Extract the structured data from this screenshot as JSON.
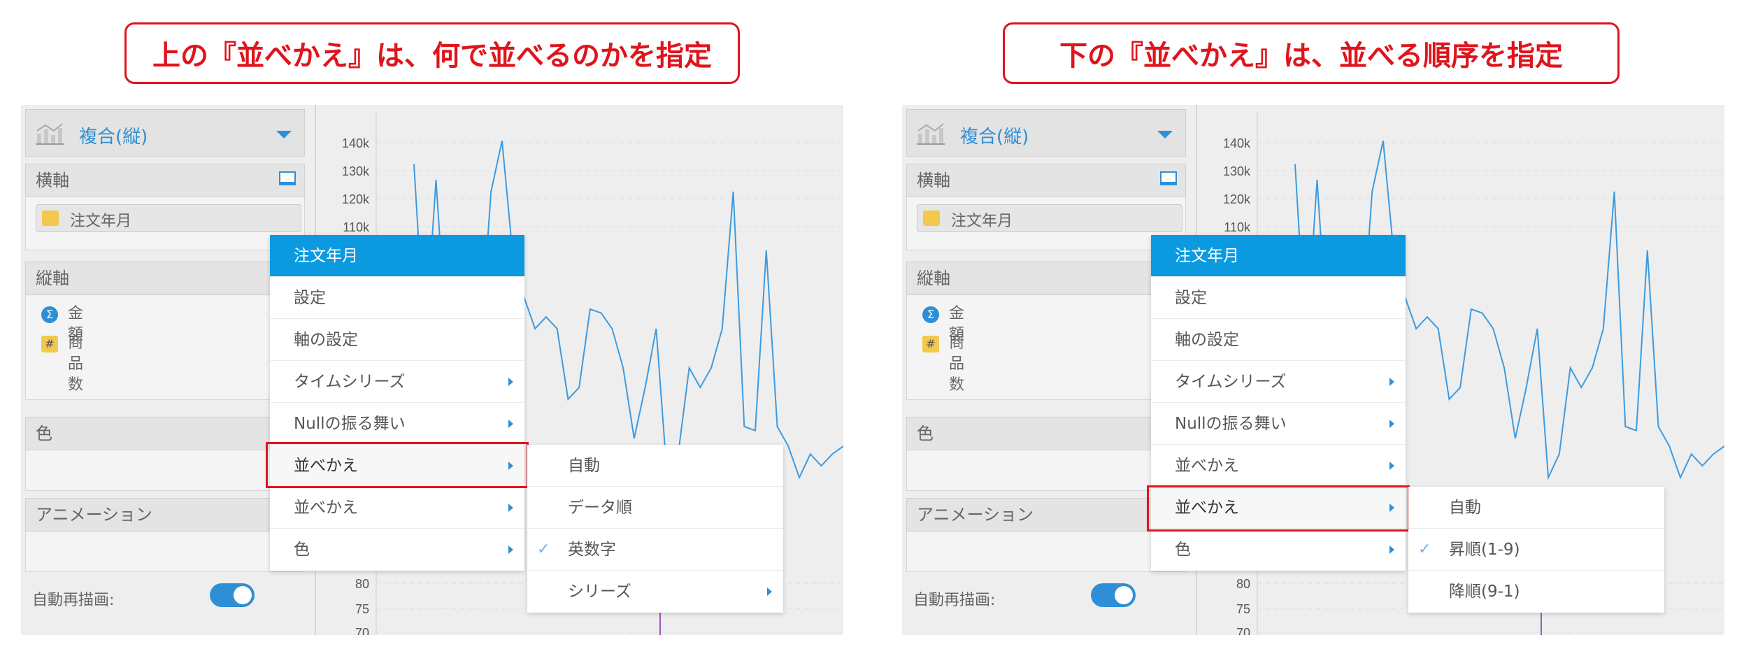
{
  "callouts": {
    "left": "上の『並べかえ』は、何で並べるのかを指定",
    "right": "下の『並べかえ』は、並べる順序を指定"
  },
  "sidebar": {
    "chart_type": "複合(縦)",
    "x_axis_title": "横軸",
    "x_field": "注文年月",
    "y_axis_title": "縦軸",
    "measures": [
      {
        "icon": "Σ",
        "label": "金額"
      },
      {
        "icon": "#",
        "label": "商品数"
      }
    ],
    "color_title": "色",
    "animation_title": "アニメーション",
    "auto_redraw_label": "自動再描画:"
  },
  "chart": {
    "y_ticks_top": [
      "140k",
      "130k",
      "120k",
      "110k"
    ],
    "y_ticks_bottom": [
      "80",
      "75",
      "70"
    ],
    "line_color": "#3d9be0",
    "purple": "#9b59b6",
    "series_points": [
      0.08,
      0.55,
      0.12,
      0.55,
      0.55,
      0.55,
      0.55,
      0.15,
      0.02,
      0.32,
      0.42,
      0.5,
      0.47,
      0.5,
      0.68,
      0.65,
      0.45,
      0.46,
      0.5,
      0.6,
      0.78,
      0.65,
      0.5,
      0.88,
      0.82,
      0.6,
      0.65,
      0.6,
      0.5,
      0.15,
      0.75,
      0.76,
      0.3,
      0.75,
      0.8,
      0.88,
      0.82,
      0.85,
      0.82,
      0.8
    ]
  },
  "left_menu": {
    "header": "注文年月",
    "items": [
      "設定",
      "軸の設定",
      "タイムシリーズ",
      "Nullの振る舞い",
      "並べかえ",
      "並べかえ",
      "色"
    ],
    "submenu": [
      "自動",
      "データ順",
      "英数字",
      "シリーズ"
    ],
    "checked_index": 2
  },
  "right_menu": {
    "header": "注文年月",
    "items": [
      "設定",
      "軸の設定",
      "タイムシリーズ",
      "Nullの振る舞い",
      "並べかえ",
      "並べかえ",
      "色"
    ],
    "submenu": [
      "自動",
      "昇順(1-9)",
      "降順(9-1)"
    ],
    "checked_index": 1
  }
}
